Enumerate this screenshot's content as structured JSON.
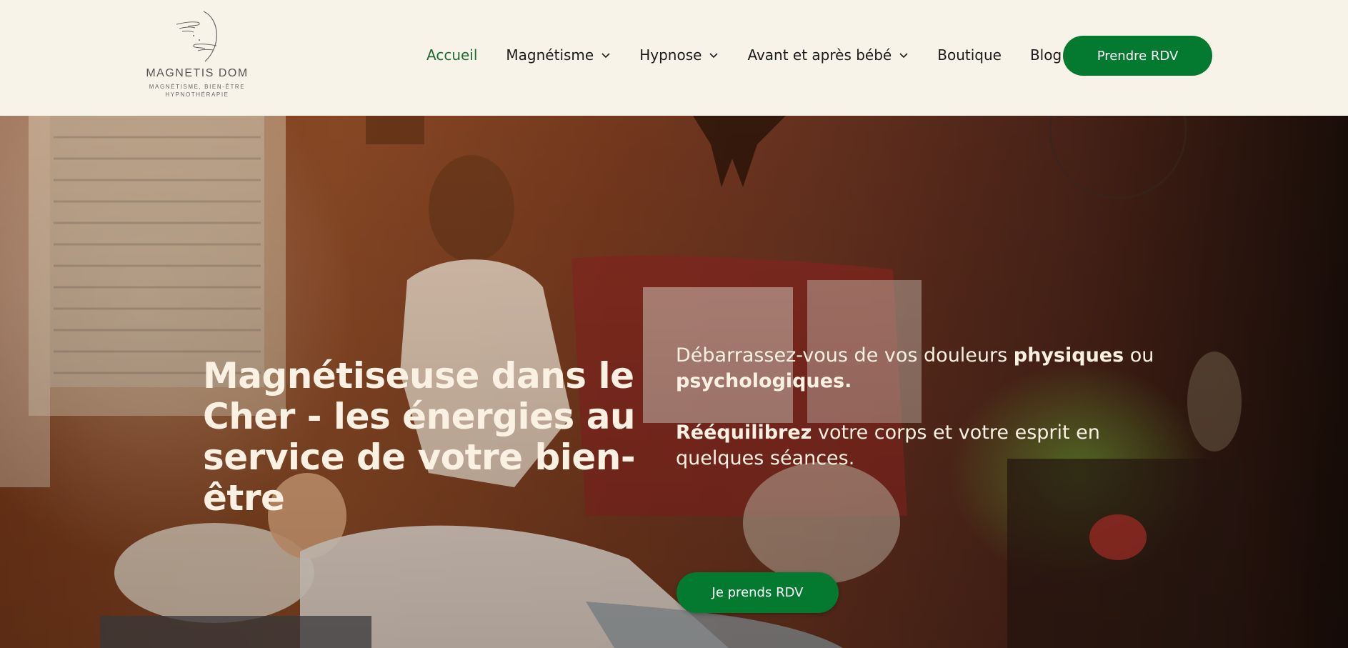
{
  "brand": {
    "name": "MAGNETIS DOM",
    "tagline_line1": "MAGNÉTISME, BIEN-ÊTRE",
    "tagline_line2": "HYPNOTHÉRAPIE",
    "logo_icon": "hands-crescent-icon"
  },
  "nav": {
    "items": [
      {
        "label": "Accueil",
        "active": true,
        "dropdown": false
      },
      {
        "label": "Magnétisme",
        "active": false,
        "dropdown": true
      },
      {
        "label": "Hypnose",
        "active": false,
        "dropdown": true
      },
      {
        "label": "Avant et après bébé",
        "active": false,
        "dropdown": true
      },
      {
        "label": "Boutique",
        "active": false,
        "dropdown": false
      },
      {
        "label": "Blog",
        "active": false,
        "dropdown": false
      }
    ],
    "cta_label": "Prendre RDV"
  },
  "hero": {
    "title": "Magnétiseuse dans le Cher - les énergies au service de votre bien-être",
    "p1_pre": "Débarrassez-vous de vos douleurs ",
    "p1_bold1": "physiques",
    "p1_mid": " ou ",
    "p1_bold2": "psychologiques.",
    "p2_bold": "Rééquilibrez",
    "p2_rest": " votre corps et votre esprit en quelques séances.",
    "cta_label": "Je prends RDV"
  },
  "colors": {
    "background": "#f8f3e8",
    "accent_green": "#047a30",
    "active_nav": "#1f6b35",
    "hero_text": "#fbf1e3"
  }
}
